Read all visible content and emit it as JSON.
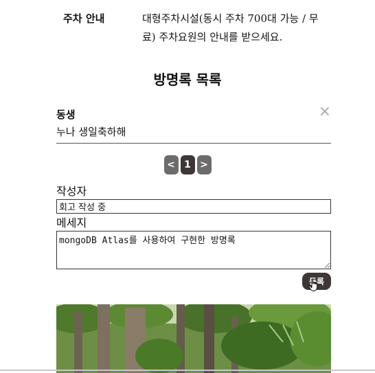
{
  "parking": {
    "label": "주차 안내",
    "text": "대형주차시설(동시 주차 700대 가능 / 무료) 주차요원의 안내를 받으세요."
  },
  "guestbook": {
    "title": "방명록 목록",
    "entries": [
      {
        "author": "동생",
        "message": "누나 생일축하해",
        "close_icon": "×"
      }
    ],
    "pagination": {
      "prev": "<",
      "current": "1",
      "next": ">"
    }
  },
  "form": {
    "author_label": "작성자",
    "author_value": "회고 작성 중",
    "message_label": "메세지",
    "message_value": "mongoDB Atlas를 사용하여 구현한 방명록",
    "submit_label": "등록"
  },
  "colors": {
    "button_dark": "#3f3636",
    "button_gray": "#6c6c6c"
  },
  "icons": {
    "close": "close-icon",
    "cursor": "hand-pointer-icon"
  }
}
